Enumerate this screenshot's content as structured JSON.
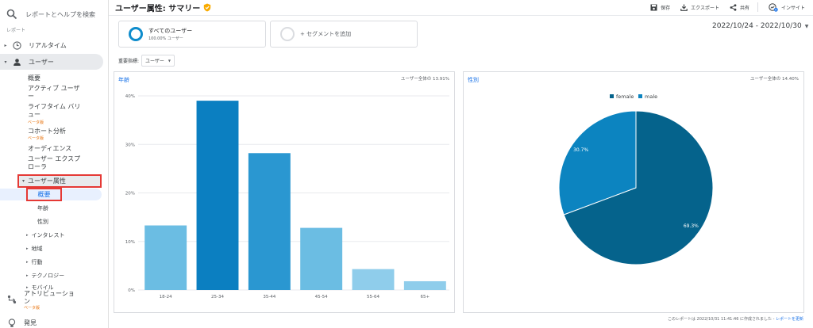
{
  "sidebar": {
    "search_placeholder": "レポートとヘルプを検索",
    "section_label": "レポート",
    "realtime": "リアルタイム",
    "user": "ユーザー",
    "user_items": {
      "overview": "概要",
      "active_users_1": "アクティブ ユーザ",
      "active_users_2": "ー",
      "lifetime_1": "ライフタイム バリ",
      "lifetime_2": "ュー",
      "lifetime_beta": "ベータ版",
      "cohort": "コホート分析",
      "cohort_beta": "ベータ版",
      "audience": "オーディエンス",
      "explorer_1": "ユーザー エクスプ",
      "explorer_2": "ローラ"
    },
    "demographics": "ユーザー属性",
    "demo_overview": "概要",
    "demo_age": "年齢",
    "demo_gender": "性別",
    "interests": "インタレスト",
    "geo": "地域",
    "behavior": "行動",
    "technology": "テクノロジー",
    "mobile": "モバイル",
    "attribution_1": "アトリビューショ",
    "attribution_2": "ン",
    "attribution_beta": "ベータ版",
    "discover": "発見"
  },
  "header": {
    "title": "ユーザー属性: サマリー",
    "save": "保存",
    "export": "エクスポート",
    "share": "共有",
    "insight": "インサイト"
  },
  "segments": {
    "all_users": "すべてのユーザー",
    "all_users_sub": "100.00% ユーザー",
    "add_segment": "+ セグメントを追加"
  },
  "date_range": "2022/10/24 - 2022/10/30",
  "metric": {
    "label": "重要指標:",
    "value": "ユーザー"
  },
  "age_card": {
    "title": "年齢",
    "note": "ユーザー全体の 13.91%"
  },
  "gender_card": {
    "title": "性別",
    "note": "ユーザー全体の 14.40%"
  },
  "footer": {
    "text": "このレポートは 2022/10/31 11:41:46 に作成されました - ",
    "link": "レポートを更新"
  },
  "colors": {
    "accent": "#1a73e8",
    "highlight_border": "#e53935"
  },
  "chart_data": [
    {
      "type": "bar",
      "title": "年齢",
      "categories": [
        "18-24",
        "25-34",
        "35-44",
        "45-54",
        "55-64",
        "65+"
      ],
      "values": [
        13.3,
        39.0,
        28.2,
        12.8,
        4.3,
        1.8
      ],
      "colors": [
        "#6bbde3",
        "#0b7fc1",
        "#2a97d1",
        "#6bbde3",
        "#8fcdeb",
        "#8fcdeb"
      ],
      "yticks": [
        "0%",
        "10%",
        "20%",
        "30%",
        "40%"
      ],
      "ylim": [
        0,
        40
      ],
      "grid": true
    },
    {
      "type": "pie",
      "title": "性別",
      "labels": [
        "female",
        "male"
      ],
      "values": [
        69.3,
        30.7
      ],
      "value_labels": [
        "69.3%",
        "30.7%"
      ],
      "colors": [
        "#05638c",
        "#0c84c0"
      ],
      "legend": "top"
    }
  ]
}
